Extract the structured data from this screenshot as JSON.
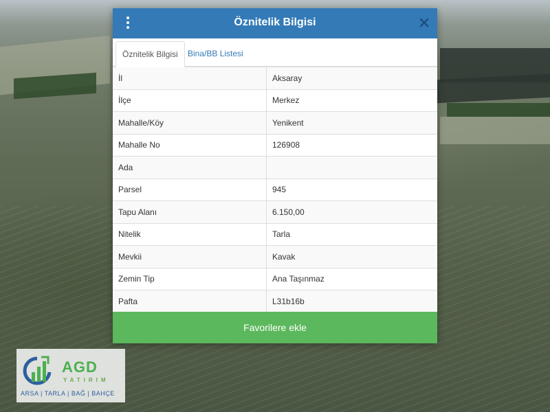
{
  "dialog": {
    "title": "Öznitelik Bilgisi",
    "tabs": [
      {
        "label": "Öznitelik Bilgisi",
        "active": true
      },
      {
        "label": "Bina/BB Listesi",
        "active": false
      }
    ],
    "rows": [
      {
        "key": "İl",
        "value": "Aksaray"
      },
      {
        "key": "İlçe",
        "value": "Merkez"
      },
      {
        "key": "Mahalle/Köy",
        "value": "Yenikent"
      },
      {
        "key": "Mahalle No",
        "value": "126908"
      },
      {
        "key": "Ada",
        "value": ""
      },
      {
        "key": "Parsel",
        "value": "945"
      },
      {
        "key": "Tapu Alanı",
        "value": "6.150,00"
      },
      {
        "key": "Nitelik",
        "value": "Tarla"
      },
      {
        "key": "Mevkii",
        "value": "Kavak"
      },
      {
        "key": "Zemin Tip",
        "value": "Ana Taşınmaz"
      },
      {
        "key": "Pafta",
        "value": "L31b16b"
      }
    ],
    "favorite_button": "Favorilere ekle"
  },
  "logo": {
    "brand": "AGD",
    "sub": "YATIRIM",
    "tagline": "ARSA | TARLA | BAĞ | BAHÇE"
  },
  "colors": {
    "header": "#337ab7",
    "button": "#5cb85c",
    "link": "#337ab7"
  },
  "icons": [
    "menu-dots-icon",
    "close-icon",
    "chart-logo-icon"
  ]
}
